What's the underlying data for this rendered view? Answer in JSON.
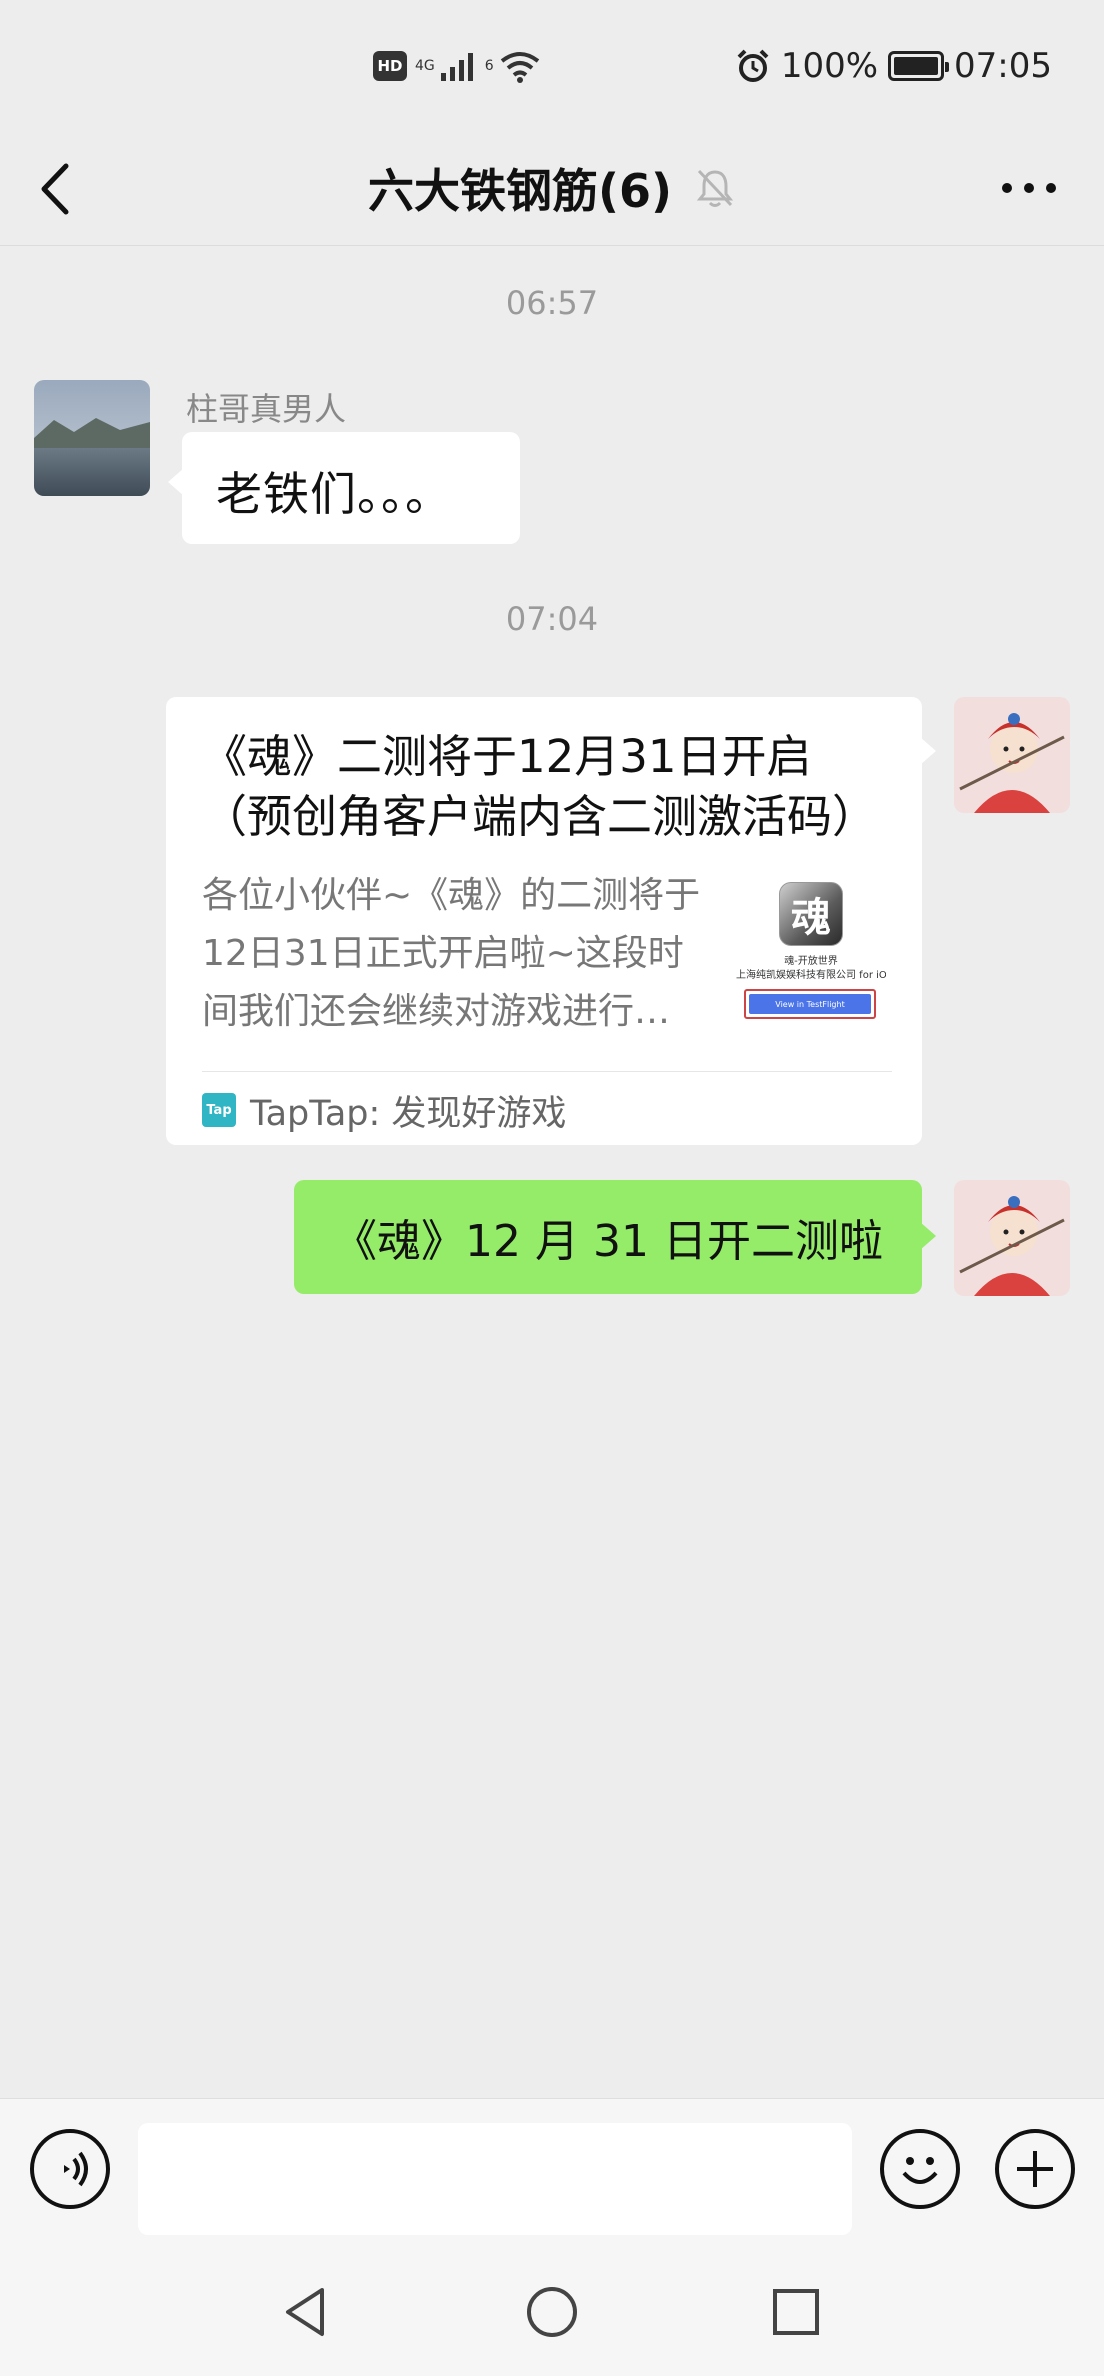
{
  "status_bar": {
    "hd_badge": "HD",
    "net_4g": "4G",
    "wifi_label": "6",
    "battery_percent": "100%",
    "time": "07:05",
    "battery_level": 1.0
  },
  "header": {
    "title": "六大铁钢筋(6)"
  },
  "messages": {
    "time_1": "06:57",
    "sender_name": "柱哥真男人",
    "text_1": "老铁们。。。",
    "time_2": "07:04",
    "card": {
      "title": "《魂》二测将于12月31日开启（预创角客户端内含二测激活码）",
      "desc": "各位小伙伴~《魂》的二测将于12日31日正式开启啦~这段时间我们还会继续对游戏进行优化",
      "thumb_icon_char": "魂",
      "thumb_line_1": "魂-开放世界",
      "thumb_line_2": "上海纯凯娱娱科技有限公司 for iOS",
      "thumb_button": "View in TestFlight",
      "source_icon": "Tap",
      "source": "TapTap: 发现好游戏"
    },
    "text_2": "《魂》12 月 31 日开二测啦"
  },
  "input_bar": {
    "placeholder": ""
  },
  "colors": {
    "background": "#ededed",
    "bubble_green": "#95ec69",
    "bubble_white": "#ffffff",
    "taptap_brand": "#2fb5c4"
  },
  "icons": {
    "back": "chevron-left-icon",
    "mute": "bell-off-icon",
    "more": "more-horizontal-icon",
    "voice": "voice-icon",
    "emoji": "emoji-icon",
    "plus": "plus-icon",
    "nav_back": "nav-back-icon",
    "nav_home": "nav-home-icon",
    "nav_recent": "nav-recent-icon"
  }
}
